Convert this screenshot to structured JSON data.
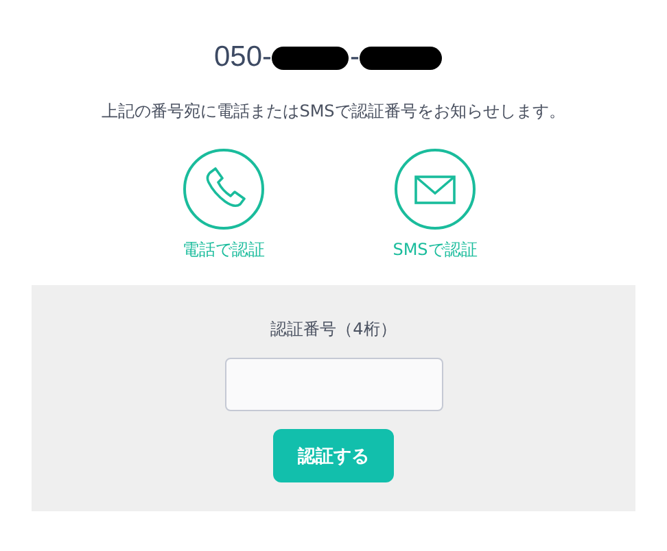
{
  "phone": {
    "prefix": "050-",
    "separator": "-"
  },
  "message": "上記の番号宛に電話またはSMSで認証番号をお知らせします。",
  "methods": [
    {
      "kind": "phone",
      "label": "電話で認証"
    },
    {
      "kind": "sms",
      "label": "SMSで認証"
    }
  ],
  "verification": {
    "label": "認証番号（4桁）",
    "button": "認証する"
  }
}
